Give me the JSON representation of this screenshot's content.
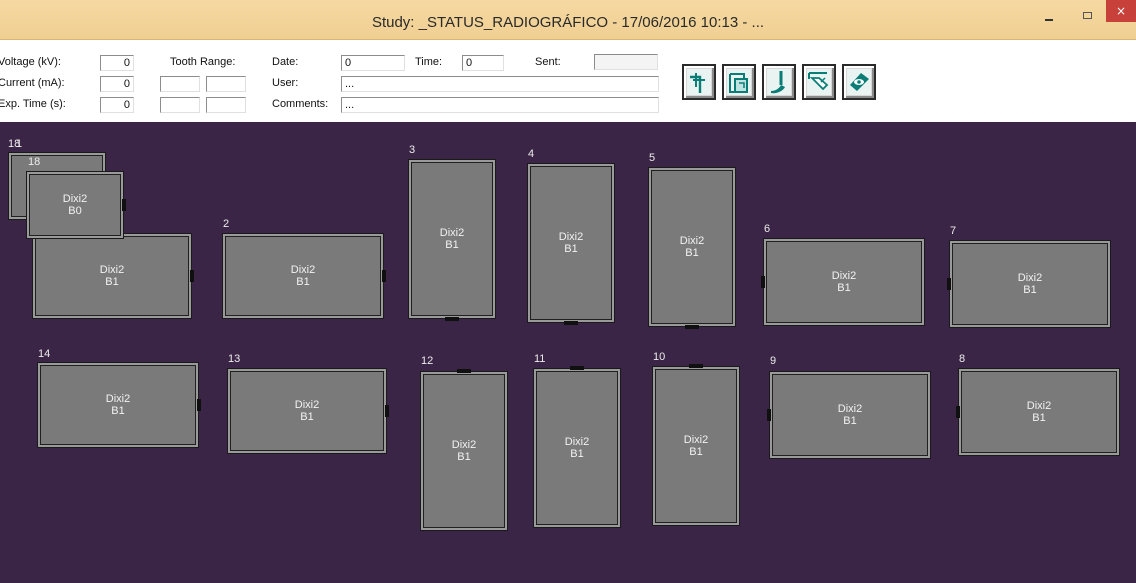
{
  "window": {
    "title": "Study: _STATUS_RADIOGRÁFICO - 17/06/2016  10:13 - ...",
    "minimize_glyph": "",
    "maximize_glyph": "",
    "close_glyph": "×"
  },
  "info": {
    "voltage_label": "Voltage (kV):",
    "voltage_value": "0",
    "current_label": "Current (mA):",
    "current_value": "0",
    "exp_time_label": "Exp. Time (s):",
    "exp_time_value": "0",
    "tooth_range_label": "Tooth Range:",
    "date_label": "Date:",
    "date_value": "0",
    "time_label": "Time:",
    "time_value": "0",
    "sent_label": "Sent:",
    "user_label": "User:",
    "user_value": "...",
    "comments_label": "Comments:",
    "comments_value": "..."
  },
  "toolbar": {
    "icons": [
      "tooth-probe-icon",
      "copy-layers-icon",
      "dental-tool-icon",
      "hand-pointer-icon",
      "eye-view-icon"
    ]
  },
  "tiles": [
    {
      "number": "18",
      "line1": "Dixi2",
      "line2": "B1"
    },
    {
      "number": "18",
      "line1": "Dixi2",
      "line2": "B0"
    },
    {
      "number": "1",
      "line1": "Dixi2",
      "line2": "B1"
    },
    {
      "number": "2",
      "line1": "Dixi2",
      "line2": "B1"
    },
    {
      "number": "3",
      "line1": "Dixi2",
      "line2": "B1"
    },
    {
      "number": "4",
      "line1": "Dixi2",
      "line2": "B1"
    },
    {
      "number": "5",
      "line1": "Dixi2",
      "line2": "B1"
    },
    {
      "number": "6",
      "line1": "Dixi2",
      "line2": "B1"
    },
    {
      "number": "7",
      "line1": "Dixi2",
      "line2": "B1"
    },
    {
      "number": "14",
      "line1": "Dixi2",
      "line2": "B1"
    },
    {
      "number": "13",
      "line1": "Dixi2",
      "line2": "B1"
    },
    {
      "number": "12",
      "line1": "Dixi2",
      "line2": "B1"
    },
    {
      "number": "11",
      "line1": "Dixi2",
      "line2": "B1"
    },
    {
      "number": "10",
      "line1": "Dixi2",
      "line2": "B1"
    },
    {
      "number": "9",
      "line1": "Dixi2",
      "line2": "B1"
    },
    {
      "number": "8",
      "line1": "Dixi2",
      "line2": "B1"
    }
  ],
  "colors": {
    "workspace_bg": "#3b2546",
    "tile_fill": "#7a7a7a",
    "titlebar_bg": "#f0cf92"
  }
}
